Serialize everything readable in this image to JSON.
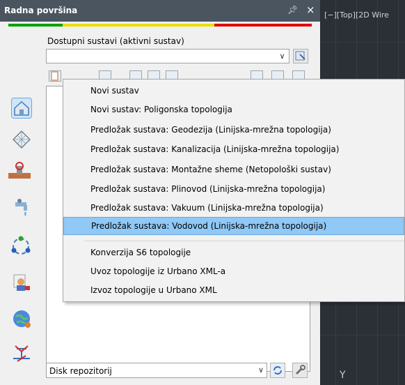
{
  "palette": {
    "title": "Radna površina",
    "pin_icon": "pin-icon",
    "close_glyph": "×",
    "status_colors": [
      "#00a000",
      "#e0e000",
      "#e00000"
    ]
  },
  "viewport": {
    "title": "[−][Top][2D Wire"
  },
  "systems": {
    "label": "Dostupni sustavi (aktivni sustav)",
    "combo_value": ""
  },
  "sidebar_icons": [
    "home-icon",
    "grid-icon",
    "pipe-valve-icon",
    "faucet-icon",
    "network-cycle-icon",
    "user-settings-icon",
    "globe-icon",
    "route-split-icon"
  ],
  "repository": {
    "combo_value": "Disk repozitorij"
  },
  "menu": {
    "items": [
      "Novi sustav",
      "Novi sustav: Poligonska topologija",
      "Predložak sustava: Geodezija (Linijska-mrežna topologija)",
      "Predložak sustava: Kanalizacija (Linijska-mrežna topologija)",
      "Predložak sustava: Montažne sheme (Netopološki sustav)",
      "Predložak sustava: Plinovod (Linijska-mrežna topologija)",
      "Predložak sustava: Vakuum (Linijska-mrežna topologija)",
      "Predložak sustava: Vodovod (Linijska-mrežna topologija)",
      "Konverzija S6 topologije",
      "Uvoz topologije iz Urbano XML-a",
      "Izvoz topologije u Urbano XML"
    ],
    "selected_index": 7,
    "highlight_color": "#90c8f6"
  }
}
